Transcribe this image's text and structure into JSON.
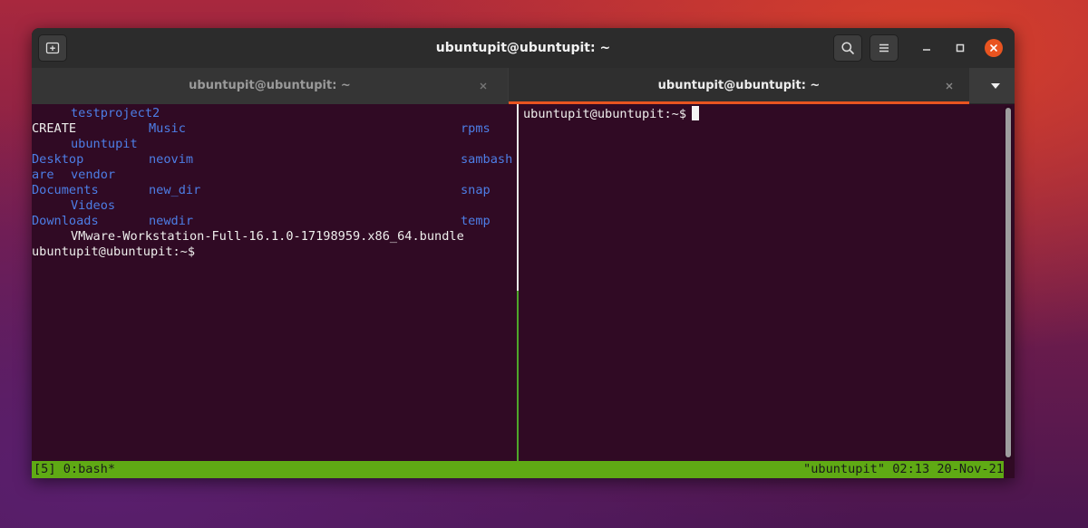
{
  "window": {
    "title": "ubuntupit@ubuntupit: ~"
  },
  "tabs": [
    {
      "label": "ubuntupit@ubuntupit: ~",
      "active": false
    },
    {
      "label": "ubuntupit@ubuntupit: ~",
      "active": true
    }
  ],
  "left_pane": {
    "lines": [
      {
        "cells": [
          {
            "text": "testproject2",
            "kind": "dir",
            "col": 5
          }
        ]
      },
      {
        "cells": [
          {
            "text": "CREATE",
            "kind": "plain",
            "col": 0
          },
          {
            "text": "Music",
            "kind": "dir",
            "col": 15
          },
          {
            "text": "rpms",
            "kind": "dir",
            "col": 55
          }
        ]
      },
      {
        "cells": [
          {
            "text": "ubuntupit",
            "kind": "dir",
            "col": 5
          }
        ]
      },
      {
        "cells": [
          {
            "text": "Desktop",
            "kind": "dir",
            "col": 0
          },
          {
            "text": "neovim",
            "kind": "dir",
            "col": 15
          },
          {
            "text": "sambash",
            "kind": "dir",
            "col": 55
          }
        ]
      },
      {
        "cells": [
          {
            "text": "are",
            "kind": "dir",
            "col": 0
          },
          {
            "text": "vendor",
            "kind": "dir",
            "col": 5
          }
        ]
      },
      {
        "cells": [
          {
            "text": "Documents",
            "kind": "dir",
            "col": 0
          },
          {
            "text": "new_dir",
            "kind": "dir",
            "col": 15
          },
          {
            "text": "snap",
            "kind": "dir",
            "col": 55
          }
        ]
      },
      {
        "cells": [
          {
            "text": "Videos",
            "kind": "dir",
            "col": 5
          }
        ]
      },
      {
        "cells": [
          {
            "text": "Downloads",
            "kind": "dir",
            "col": 0
          },
          {
            "text": "newdir",
            "kind": "dir",
            "col": 15
          },
          {
            "text": "temp",
            "kind": "dir",
            "col": 55
          }
        ]
      },
      {
        "cells": [
          {
            "text": "VMware-Workstation-Full-16.1.0-17198959.x86_64.bundle",
            "kind": "plain",
            "col": 5
          }
        ]
      },
      {
        "cells": [
          {
            "text": "ubuntupit@ubuntupit:~$",
            "kind": "plain",
            "col": 0
          }
        ]
      }
    ]
  },
  "right_pane": {
    "prompt": "ubuntupit@ubuntupit:~$"
  },
  "status_bar": {
    "left": "[5] 0:bash*",
    "right": "\"ubuntupit\" 02:13 20-Nov-21"
  },
  "colors": {
    "accent": "#e95420",
    "terminal_bg": "#300a24",
    "directory": "#4d7ee6",
    "status_bar": "#5faa14"
  }
}
